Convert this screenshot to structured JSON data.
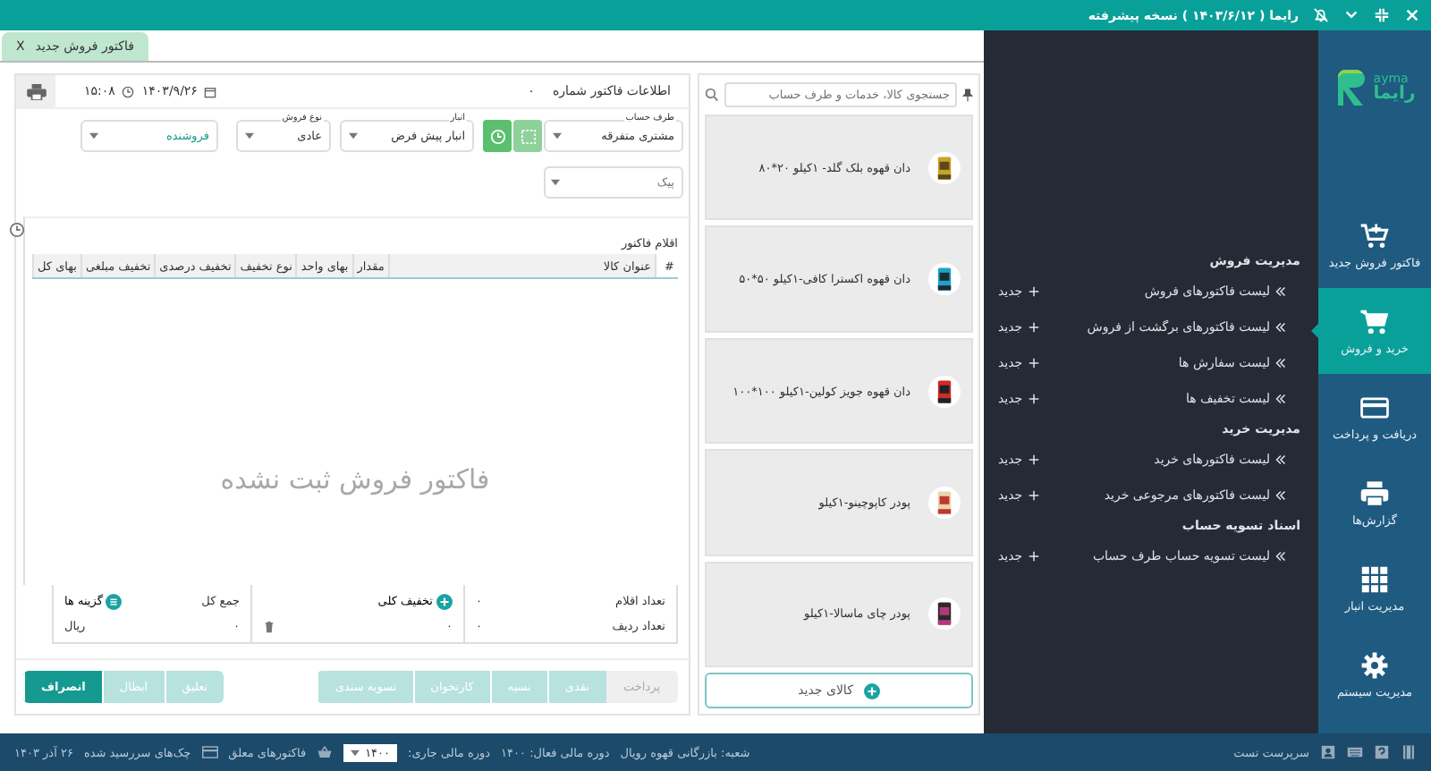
{
  "title_bar": {
    "title": "رایما ( ۱۴۰۳/۶/۱۲ ) نسخه پیشرفته"
  },
  "nav": {
    "logo_latin": "ayma",
    "logo_text": "رایما",
    "items": [
      {
        "label": "فاکتور فروش جدید",
        "selected": false
      },
      {
        "label": "خرید و فروش",
        "selected": true
      },
      {
        "label": "دریافت و پرداخت",
        "selected": false
      },
      {
        "label": "گزارش‌ها",
        "selected": false
      },
      {
        "label": "مدیریت انبار",
        "selected": false
      },
      {
        "label": "مدیریت سیستم",
        "selected": false
      }
    ]
  },
  "menu": {
    "sections": [
      {
        "title": "مدیریت فروش",
        "items": [
          {
            "label": "لیست فاکتورهای فروش",
            "new": "جدید"
          },
          {
            "label": "لیست فاکتورهای برگشت از فروش",
            "new": "جدید"
          },
          {
            "label": "لیست سفارش ها",
            "new": "جدید"
          },
          {
            "label": "لیست تخفیف ها",
            "new": "جدید"
          }
        ]
      },
      {
        "title": "مدیریت خرید",
        "items": [
          {
            "label": "لیست فاکتورهای خرید",
            "new": "جدید"
          },
          {
            "label": "لیست فاکتورهای مرجوعی خرید",
            "new": "جدید"
          }
        ]
      },
      {
        "title": "اسناد تسویه حساب",
        "items": [
          {
            "label": "لیست تسویه حساب طرف حساب",
            "new": "جدید"
          }
        ]
      }
    ]
  },
  "tabs": [
    {
      "label": "فاکتور فروش جدید",
      "close": "X",
      "selected": true
    }
  ],
  "products": {
    "search": {
      "placeholder": "جستجوی کالا، خدمات و طرف حساب"
    },
    "items": [
      {
        "name": "دان قهوه بلک گلد- ۱کیلو ۲۰*۸۰"
      },
      {
        "name": "دان قهوه اکسترا کافی-۱کیلو ۵۰*۵۰"
      },
      {
        "name": "دان قهوه جویز کولین-۱کیلو ۱۰۰*۱۰۰"
      },
      {
        "name": "پودر کاپوچینو-۱کیلو"
      },
      {
        "name": "پودر چای ماسالا-۱کیلو"
      }
    ],
    "new_button": "کالای جدید"
  },
  "invoice": {
    "title": "اطلاعات فاکتور شماره",
    "number": "۰",
    "date": "۱۴۰۳/۹/۲۶",
    "time": "۱۵:۰۸",
    "fields": [
      {
        "label": "طرف حساب",
        "value": "مشتری متفرقه",
        "highlighted": false
      },
      {
        "label": "انبار",
        "value": "انبار پیش فرض",
        "highlighted": false
      },
      {
        "label": "نوع فروش",
        "value": "عادی",
        "highlighted": false
      },
      {
        "value": "فروشنده",
        "highlighted": true
      }
    ],
    "courier": {
      "placeholder": "پیک"
    },
    "items_title": "اقلام فاکتور",
    "columns": [
      "#",
      "عنوان کالا",
      "مقدار",
      "بهای واحد",
      "نوع تخفیف",
      "تخفیف درصدی",
      "تخفیف مبلغی",
      "بهای کل"
    ],
    "empty_message": "فاکتور فروش ثبت نشده",
    "totals": {
      "items_label": "تعداد اقلام",
      "items": "۰",
      "rows_label": "تعداد ردیف",
      "rows": "۰",
      "discount_label": "تخفیف کلی",
      "discount": "۰",
      "total_label": "جمع کل",
      "total": "۰",
      "currency": "ریال",
      "options_label": "گزینه ها"
    },
    "payment_label": "پرداخت",
    "payment_methods": [
      {
        "label": "نقدی",
        "disabled": true
      },
      {
        "label": "نسیه",
        "disabled": true
      },
      {
        "label": "کارتخوان",
        "disabled": true
      },
      {
        "label": "تسویه سندی",
        "disabled": true
      }
    ],
    "actions": [
      {
        "label": "تعلیق",
        "disabled": true
      },
      {
        "label": "ابطال",
        "disabled": true
      },
      {
        "label": "انصراف",
        "disabled": false
      }
    ]
  },
  "status_bar": {
    "user": "سرپرست تست",
    "branch": "شعبه: بازرگانی قهوه رویال",
    "active_period": "دوره مالی فعال: ۱۴۰۰",
    "current_period_label": "دوره مالی جاری:",
    "current_period": "۱۴۰۰",
    "suspended": "فاکتورهای معلق",
    "due_checks": "چک‌های سررسید شده",
    "date": "۲۶ آذر ۱۴۰۳"
  }
}
